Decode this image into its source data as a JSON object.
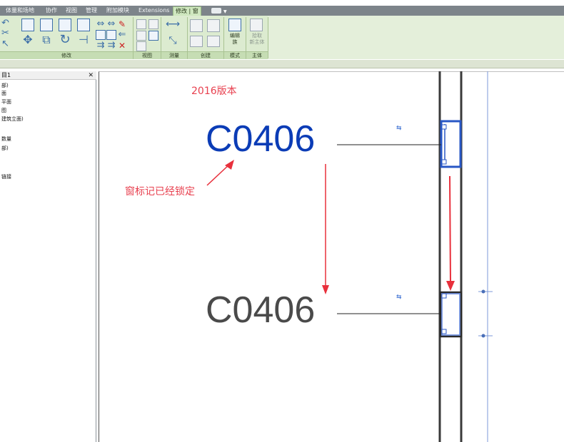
{
  "ribbon_tabs": [
    "体量和场地",
    "协作",
    "视图",
    "管理",
    "附加模块",
    "Extensions",
    "修改 | 窗"
  ],
  "active_tab": "修改 | 窗",
  "ribbon_panels": {
    "modify": "修改",
    "view": "视图",
    "measure": "测量",
    "create": "创建",
    "mode": "模式",
    "host": "主体"
  },
  "ribbon_buttons": {
    "edit_family_line1": "编辑",
    "edit_family_line2": "族",
    "pick_host_line1": "拾取",
    "pick_host_line2": "新主体"
  },
  "project_browser": {
    "title": "目1",
    "items": [
      "部)",
      "面",
      "平面",
      "图",
      "建筑立面)",
      "数量",
      "部)",
      "链接"
    ]
  },
  "canvas": {
    "version_label": "2016版本",
    "tag_top": "C0406",
    "tag_bottom": "C0406",
    "annotation": "窗标记已经锁定"
  },
  "colors": {
    "ribbon_green": "#dcebd0",
    "tag_selected": "#0b3cb6",
    "tag_normal": "#4a4a4a",
    "annotation_red": "#e8404f",
    "wall_line": "#3a3a3a",
    "window_blue": "#2857c5"
  }
}
